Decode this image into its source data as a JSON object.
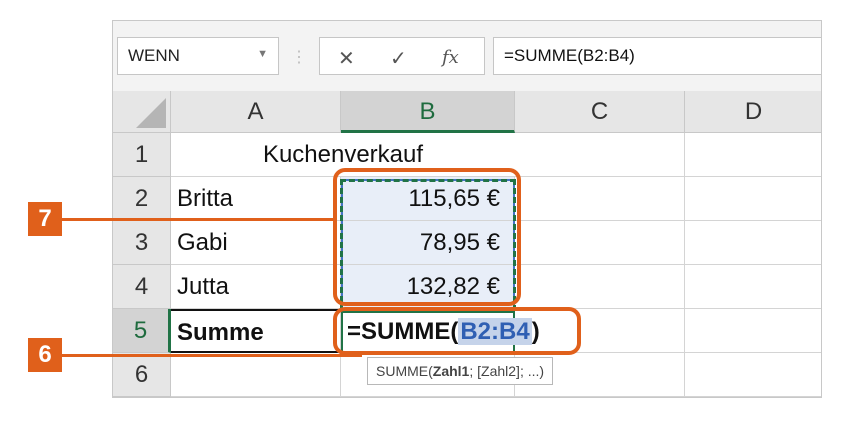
{
  "formula_bar": {
    "namebox": "WENN",
    "cancel_glyph": "✕",
    "confirm_glyph": "✓",
    "fx_glyph": "fx",
    "formula": "=SUMME(B2:B4)"
  },
  "columns": [
    "A",
    "B",
    "C",
    "D"
  ],
  "rows": [
    "1",
    "2",
    "3",
    "4",
    "5",
    "6"
  ],
  "cells": {
    "a1": "Kuchenverkauf",
    "a2": "Britta",
    "a3": "Gabi",
    "a4": "Jutta",
    "a5": "Summe",
    "b2": "115,65 €",
    "b3": "78,95 €",
    "b4": "132,82 €"
  },
  "editing": {
    "prefix": "=SUMME(",
    "ref": "B2:B4",
    "suffix": ")"
  },
  "tooltip": {
    "func": "SUMME(",
    "arg1": "Zahl1",
    "rest": "; [Zahl2]; ...)"
  },
  "callouts": {
    "seven": "7",
    "six": "6"
  },
  "colors": {
    "accent_orange": "#e0601b",
    "excel_green": "#217346",
    "ref_blue": "#2f5fb3"
  }
}
